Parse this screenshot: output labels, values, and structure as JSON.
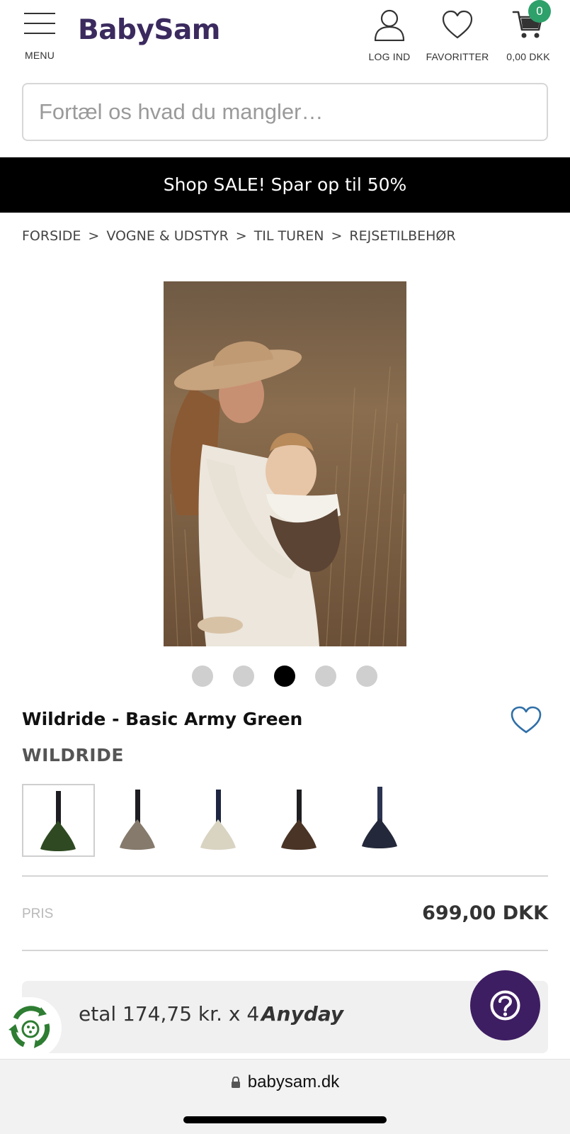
{
  "header": {
    "menu_label": "MENU",
    "logo": "BabySam",
    "login_label": "LOG IND",
    "favorites_label": "FAVORITTER",
    "cart_total": "0,00 DKK",
    "cart_count": "0"
  },
  "search": {
    "placeholder": "Fortæl os hvad du mangler…"
  },
  "promo": {
    "text": "Shop SALE! Spar op til 50%"
  },
  "breadcrumb": [
    "FORSIDE",
    "VOGNE & UDSTYR",
    "TIL TUREN",
    "REJSETILBEHØR"
  ],
  "breadcrumb_separator": ">",
  "gallery": {
    "total": 5,
    "active_index": 2
  },
  "product": {
    "title": "Wildride - Basic Army Green",
    "brand": "WILDRIDE",
    "variants": [
      {
        "color": "#2f4a22",
        "selected": true
      },
      {
        "color": "#857a6c",
        "selected": false
      },
      {
        "color": "#d9d4c2",
        "selected": false
      },
      {
        "color": "#4a3426",
        "selected": false
      },
      {
        "color": "#23283a",
        "selected": false
      }
    ],
    "price_label": "PRIS",
    "price": "699,00 DKK"
  },
  "anyday": {
    "text": "etal 174,75 kr. x 4",
    "brand": "Anyday"
  },
  "icons": {
    "menu": "hamburger-icon",
    "login": "user-icon",
    "favorites": "heart-icon",
    "cart": "cart-icon",
    "help": "question-icon",
    "eco": "recycle-icon",
    "lock": "lock-icon"
  },
  "colors": {
    "brand": "#3b2a5e",
    "badge": "#2ea06a",
    "heart_accent": "#2f6fa8",
    "help_button": "#3e1e62",
    "promo_bg": "#000000"
  },
  "browser": {
    "url": "babysam.dk"
  }
}
